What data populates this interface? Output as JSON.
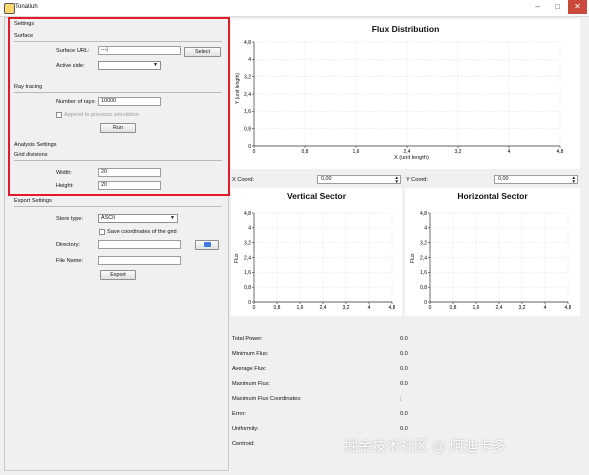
{
  "window": {
    "title": "Tonatiuh",
    "minimize_label": "–",
    "maximize_label": "□",
    "close_label": "✕"
  },
  "settings": {
    "section_title": "Settings",
    "surface_title": "Surface",
    "surface_url_label": "Surface URL:",
    "surface_url_value": "---|",
    "select_label": "Select",
    "active_side_label": "Active side:",
    "active_side_value": ""
  },
  "ray_tracing": {
    "section_title": "Ray tracing",
    "number_of_rays_label": "Number of rays:",
    "number_of_rays_value": "10000",
    "append_label": "Append to previous simulation",
    "run_label": "Run"
  },
  "analysis": {
    "section_title": "Analysis Settings",
    "grid_divisions_label": "Grid divisions",
    "width_label": "Width:",
    "width_value": "20",
    "height_label": "Height:",
    "height_value": "20"
  },
  "export": {
    "section_title": "Export Settings",
    "store_type_label": "Store type:",
    "store_type_value": "ASCII",
    "save_coords_label": "Save coordinates of the grid",
    "directory_label": "Directory:",
    "file_name_label": "File Name:",
    "export_label": "Export"
  },
  "flux_plot": {
    "title": "Flux Distribution",
    "xlabel": "X (unit length)",
    "ylabel": "Y (unit length)",
    "x_ticks": [
      "0",
      "0,8",
      "1,6",
      "2,4",
      "3,2",
      "4",
      "4,8"
    ],
    "y_ticks": [
      "0",
      "0,8",
      "1,6",
      "2,4",
      "3,2",
      "4",
      "4,8"
    ]
  },
  "coords": {
    "x_label": "X Coord:",
    "x_value": "0,00",
    "y_label": "Y Coord:",
    "y_value": "0,00"
  },
  "vertical_plot": {
    "title": "Vertical Sector",
    "ylabel": "Flux",
    "x_ticks": [
      "0",
      "0,8",
      "1,6",
      "2,4",
      "3,2",
      "4",
      "4,8"
    ],
    "y_ticks": [
      "0",
      "0,8",
      "1,6",
      "2,4",
      "3,2",
      "4",
      "4,8"
    ]
  },
  "horizontal_plot": {
    "title": "Horizontal Sector",
    "ylabel": "Flux",
    "x_ticks": [
      "0",
      "0,8",
      "1,6",
      "2,4",
      "3,2",
      "4",
      "4,8"
    ],
    "y_ticks": [
      "0",
      "0,8",
      "1,6",
      "2,4",
      "3,2",
      "4",
      "4,8"
    ]
  },
  "stats": [
    {
      "label": "Total Power:",
      "value": "0.0"
    },
    {
      "label": "Minimum Flux:",
      "value": "0.0"
    },
    {
      "label": "Average Flux:",
      "value": "0.0"
    },
    {
      "label": "Maximum Flux:",
      "value": "0.0"
    },
    {
      "label": "Maximum Flux Coordinates:",
      "value": ";"
    },
    {
      "label": "Error:",
      "value": "0.0"
    },
    {
      "label": "Uniformity:",
      "value": "0.0"
    },
    {
      "label": "Centroid:",
      "value": ""
    }
  ],
  "watermark": "掘金技术社区 @ 阿迪卡多"
}
